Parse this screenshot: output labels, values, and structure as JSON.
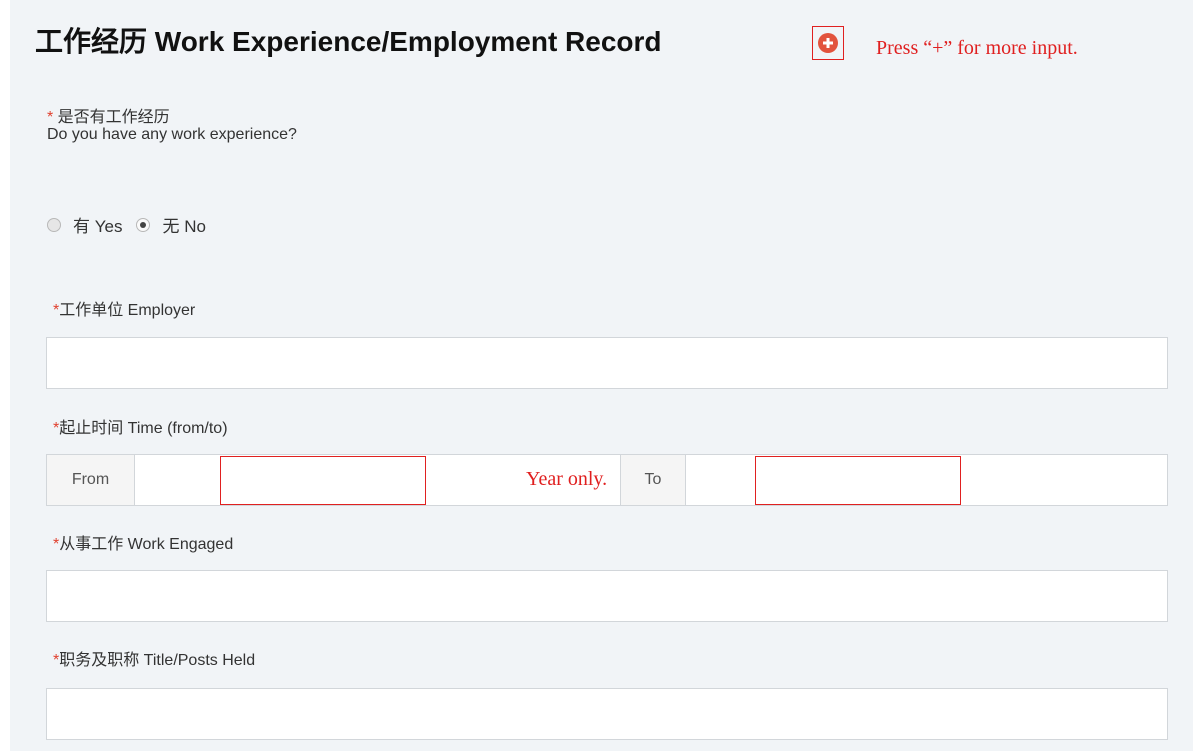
{
  "section": {
    "title": "工作经历 Work Experience/Employment Record",
    "add_note": "Press “+” for more input.",
    "add_icon": "plus-circle-icon",
    "accent_color": "#e2533d",
    "annotation_color": "#e01f1f"
  },
  "work_question": {
    "required_mark": "*",
    "label_cn": " 是否有工作经历",
    "label_en": "Do you have any work experience?",
    "options": [
      {
        "label": "有 Yes",
        "checked": false
      },
      {
        "label": "无 No",
        "checked": true
      }
    ]
  },
  "employer": {
    "required_mark": "*",
    "label": "工作单位 Employer",
    "value": ""
  },
  "time": {
    "required_mark": "*",
    "label": "起止时间 Time (from/to)",
    "from_label": "From",
    "to_label": "To",
    "year_note": "Year only.",
    "from_value": "",
    "to_value": ""
  },
  "work_engaged": {
    "required_mark": "*",
    "label": "从事工作 Work Engaged",
    "value": ""
  },
  "title_posts": {
    "required_mark": "*",
    "label": "职务及职称 Title/Posts Held",
    "value": ""
  }
}
